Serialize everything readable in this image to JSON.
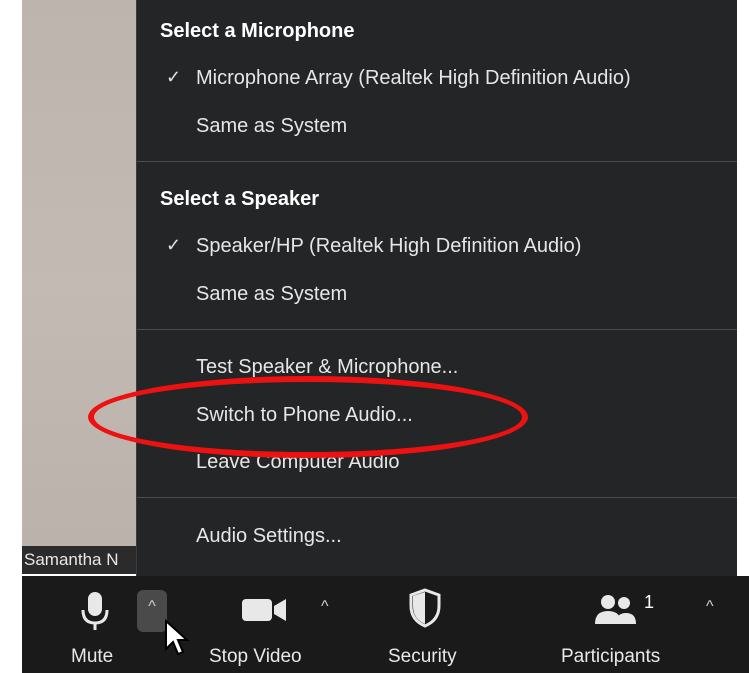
{
  "participant": {
    "name_tag": "Samantha N"
  },
  "audio_menu": {
    "microphone_header": "Select a Microphone",
    "microphone_selected": "Microphone Array (Realtek High Definition Audio)",
    "microphone_same_as_system": "Same as System",
    "speaker_header": "Select a Speaker",
    "speaker_selected": "Speaker/HP (Realtek High Definition Audio)",
    "speaker_same_as_system": "Same as System",
    "check_mark": "✓",
    "test_speaker_mic": "Test Speaker & Microphone...",
    "switch_to_phone": "Switch to Phone Audio...",
    "leave_computer_audio": "Leave Computer Audio",
    "audio_settings": "Audio Settings..."
  },
  "toolbar": {
    "mute_label": "Mute",
    "stop_video_label": "Stop Video",
    "security_label": "Security",
    "participants_label": "Participants",
    "participants_count": "1",
    "caret": "^"
  },
  "colors": {
    "menu_bg": "#242526",
    "toolbar_bg": "#1a1a1a",
    "highlight": "#ee1111"
  },
  "icons": [
    "microphone-icon",
    "video-camera-icon",
    "shield-icon",
    "participants-icon",
    "mouse-cursor-icon"
  ]
}
